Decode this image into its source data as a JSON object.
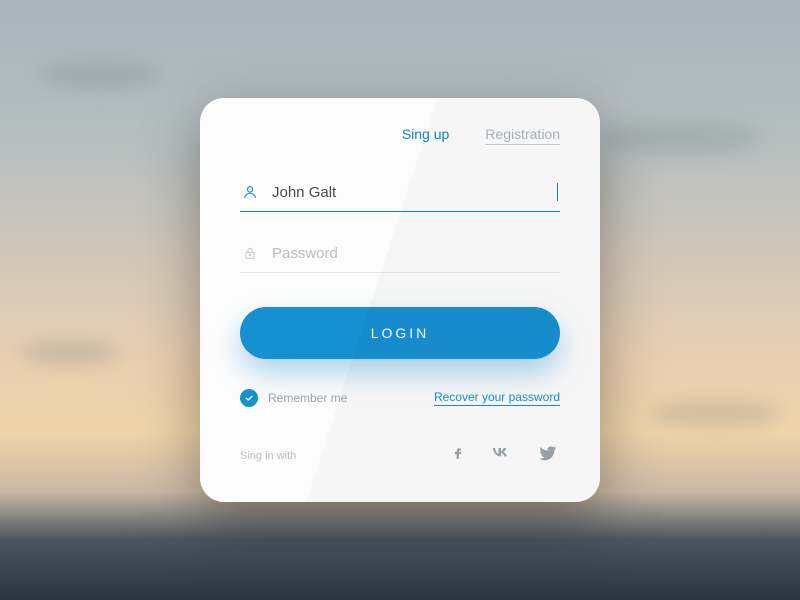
{
  "tabs": {
    "signup": "Sing up",
    "registration": "Registration"
  },
  "fields": {
    "username_value": "John Galt",
    "password_placeholder": "Password"
  },
  "login_button": "LOGIN",
  "remember_label": "Remember me",
  "recover_label": "Recover your password",
  "social_label": "Sing in with",
  "colors": {
    "accent": "#1790d2",
    "muted": "#a8b5bd"
  }
}
